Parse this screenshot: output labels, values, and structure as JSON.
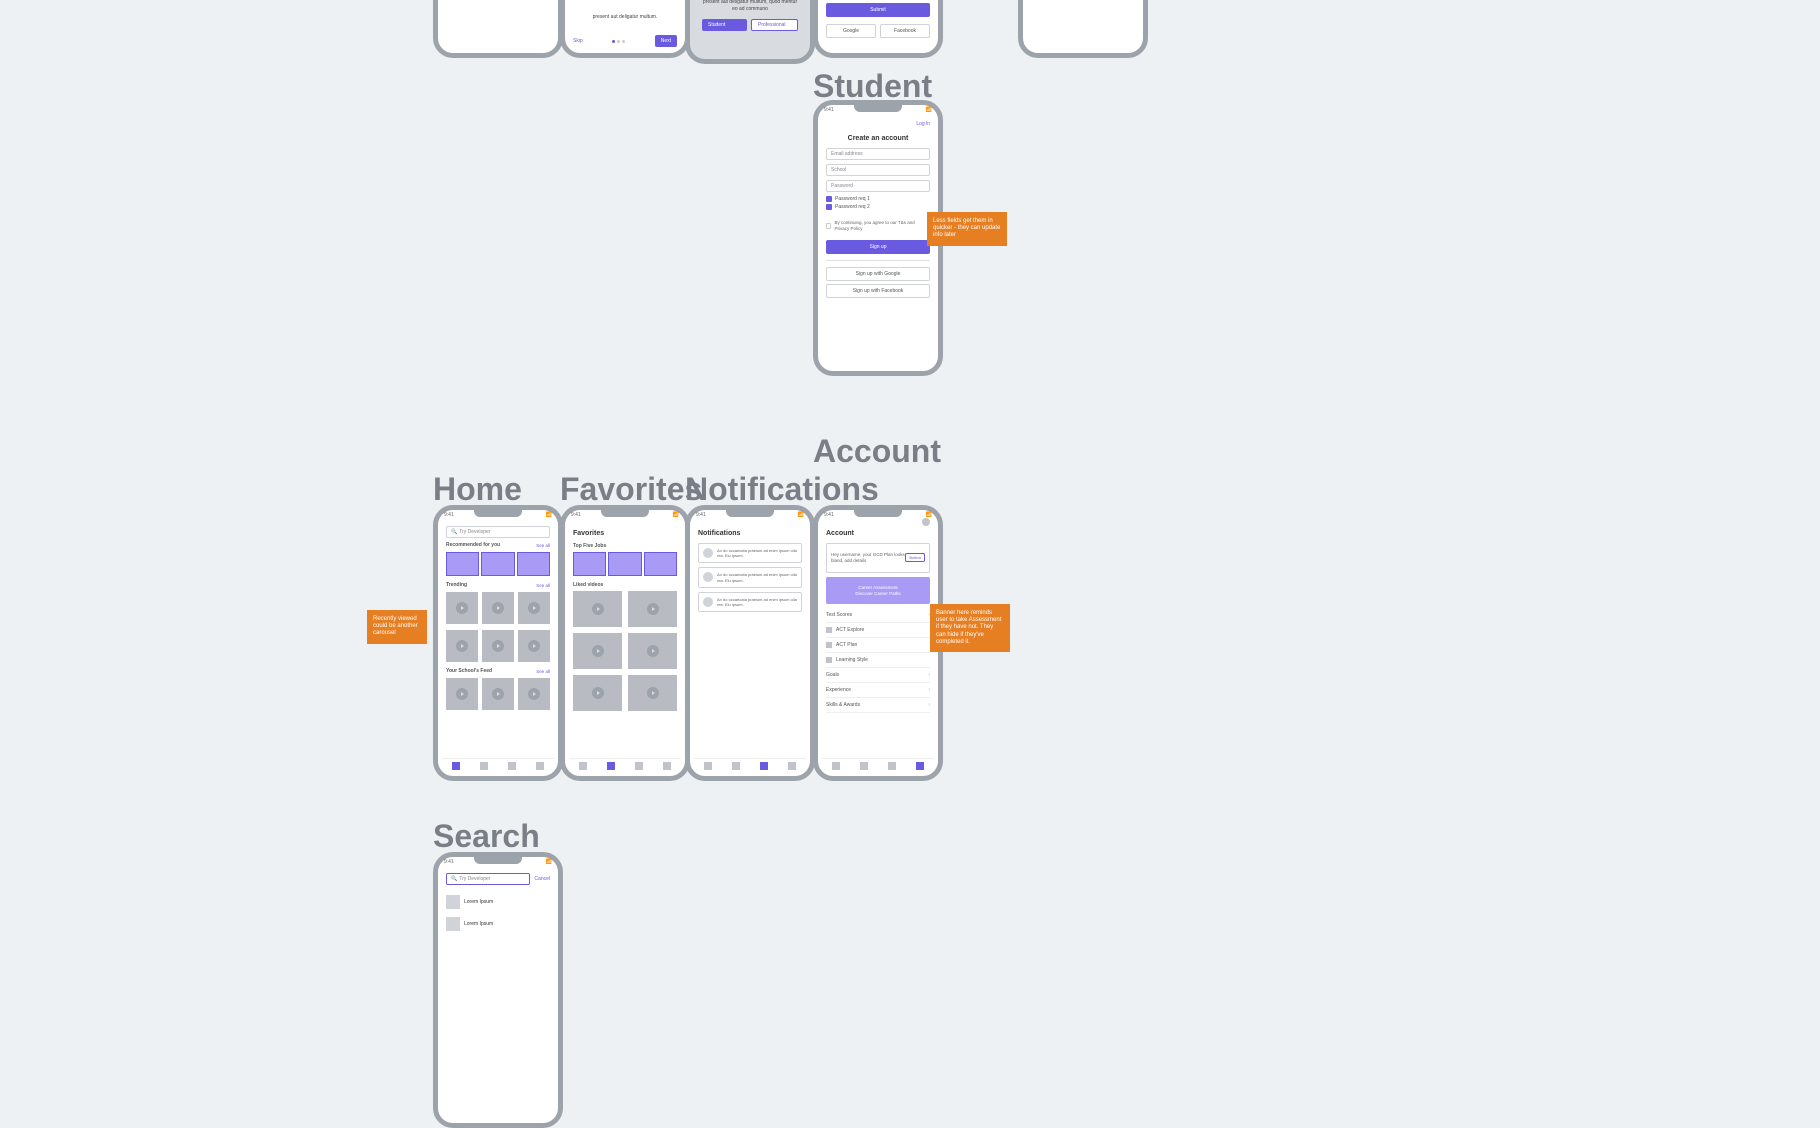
{
  "headings": {
    "student": "Student",
    "account": "Account",
    "home": "Home",
    "favorites": "Favorites",
    "notifications": "Notifications",
    "search": "Search"
  },
  "onboard": {
    "text": "present aut deligatur multum.",
    "skip": "Skip",
    "next": "Next",
    "text2": "present aut deligatur multum, quod mentur eo ad communo"
  },
  "signup_top": {
    "submit": "Submit",
    "student": "Student",
    "professional": "Professional",
    "google": "Google",
    "facebook": "Facebook"
  },
  "student_signup": {
    "login": "Log in",
    "title": "Create an account",
    "email": "Email address",
    "school": "School",
    "password": "Password",
    "req1": "Password req 1",
    "req2": "Password req 2",
    "terms": "By continuing, you agree to our T&s and Privacy Policy",
    "signup": "Sign up",
    "google": "Sign up with Google",
    "facebook": "Sign up with Facebook"
  },
  "sticky_school": "Less fields get them in quicker - they can update info later",
  "home": {
    "search": "Try Developer",
    "rec": "Recommended for you",
    "seeall": "See all",
    "trending": "Trending",
    "school_feed": "Your School's Feed"
  },
  "sticky_home": "Recently viewed could be another carousel",
  "favorites": {
    "title": "Favorites",
    "top": "Top Five Jobs",
    "liked": "Liked videos"
  },
  "notifications": {
    "title": "Notifications",
    "item": "An do occaecata praeiunt ad enim ipsum olla rea. Eiu ipsum."
  },
  "account": {
    "title": "Account",
    "banner_text": "Hey username, your GCD Plan looks bland, add details",
    "button": "Button",
    "assessment": "Career Assessment",
    "path": "Discover Career Paths",
    "test": "Test Scores",
    "act": "ACT Explore",
    "plan": "ACT Plan",
    "style": "Learning Style",
    "goals": "Goals",
    "exp": "Experience",
    "skills": "Skills & Awards"
  },
  "sticky_account": "Banner here reminds user to take Assessment if they have not. They can hide if they've completed it.",
  "search": {
    "placeholder": "Try Developer",
    "cancel": "Cancel",
    "result": "Lorem Ipsum"
  }
}
